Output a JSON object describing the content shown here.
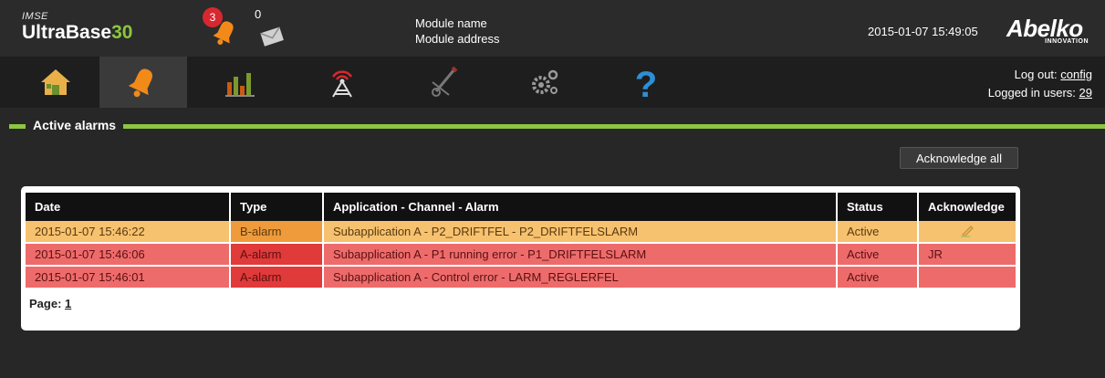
{
  "brand": {
    "small": "IMSE",
    "big": "UltraBase",
    "number": "30"
  },
  "notifications": {
    "alarm_count": "3",
    "message_count": "0"
  },
  "module": {
    "name": "Module name",
    "address": "Module address"
  },
  "datetime": "2015-01-07 15:49:05",
  "logo": {
    "main": "Abelko",
    "sub": "INNOVATION"
  },
  "nav": [
    "home-icon",
    "alarm-bell-icon",
    "chart-icon",
    "antenna-icon",
    "tools-icon",
    "gears-icon",
    "help-icon"
  ],
  "login": {
    "logout_label": "Log out:",
    "user": "config",
    "users_label": "Logged in users:",
    "users_count": "29"
  },
  "section": {
    "title": "Active alarms"
  },
  "buttons": {
    "ack_all": "Acknowledge all"
  },
  "table": {
    "columns": [
      "Date",
      "Type",
      "Application - Channel - Alarm",
      "Status",
      "Acknowledge"
    ],
    "rows": [
      {
        "date": "2015-01-07 15:46:22",
        "type": "B-alarm",
        "alarm": "Subapplication A - P2_DRIFTFEL - P2_DRIFTFELSLARM",
        "status": "Active",
        "ack": ""
      },
      {
        "date": "2015-01-07 15:46:06",
        "type": "A-alarm",
        "alarm": "Subapplication A - P1 running error - P1_DRIFTFELSLARM",
        "status": "Active",
        "ack": "JR"
      },
      {
        "date": "2015-01-07 15:46:01",
        "type": "A-alarm",
        "alarm": "Subapplication A - Control error - LARM_REGLERFEL",
        "status": "Active",
        "ack": ""
      }
    ]
  },
  "pager": {
    "label": "Page:",
    "page": "1"
  },
  "colors": {
    "accent": "#8cc63f",
    "b_alarm": "#f7c26f",
    "a_alarm": "#ee6b6b",
    "badge": "#d7282f"
  }
}
